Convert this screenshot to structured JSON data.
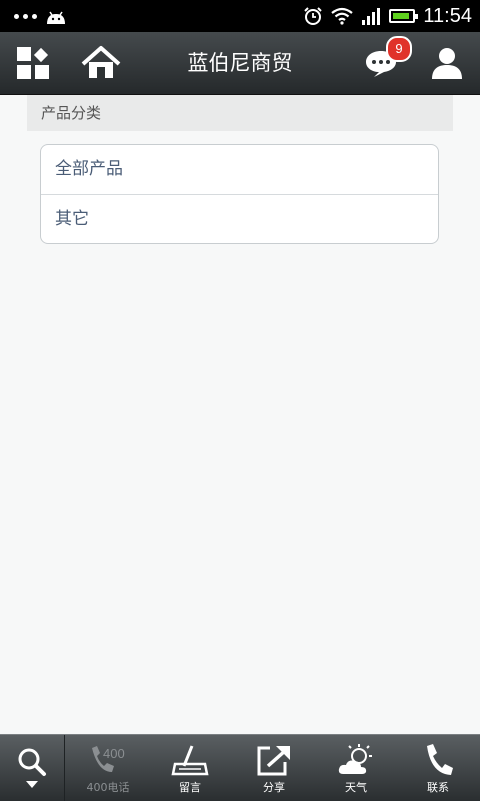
{
  "status_bar": {
    "time": "11:54",
    "battery_level": 0.9
  },
  "header": {
    "title": "蓝伯尼商贸",
    "message_badge": "9",
    "icons": [
      "apps-grid-icon",
      "home-icon",
      "chat-bubble-icon",
      "user-profile-icon"
    ]
  },
  "section": {
    "title": "产品分类"
  },
  "categories": [
    {
      "label": "全部产品"
    },
    {
      "label": "其它"
    }
  ],
  "bottom_bar": {
    "tabs": [
      {
        "label": "400电话",
        "icon": "phone-400-icon",
        "enabled": false
      },
      {
        "label": "留言",
        "icon": "write-note-icon",
        "enabled": true
      },
      {
        "label": "分享",
        "icon": "share-icon",
        "enabled": true
      },
      {
        "label": "天气",
        "icon": "weather-icon",
        "enabled": true
      },
      {
        "label": "联系",
        "icon": "phone-icon",
        "enabled": true
      }
    ]
  }
}
